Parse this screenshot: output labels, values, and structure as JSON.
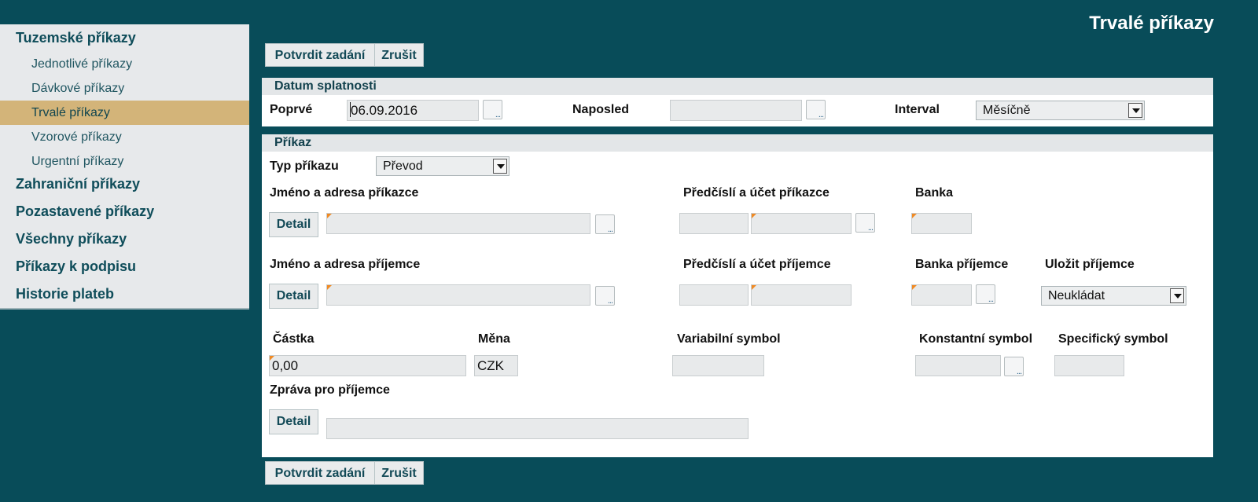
{
  "page_title": "Trvalé příkazy",
  "sidebar": {
    "tuzemske": {
      "title": "Tuzemské příkazy",
      "items": [
        "Jednotlivé příkazy",
        "Dávkové příkazy",
        "Trvalé příkazy",
        "Vzorové příkazy",
        "Urgentní příkazy"
      ],
      "active_item": "Trvalé příkazy"
    },
    "groups": [
      "Zahraniční příkazy",
      "Pozastavené příkazy",
      "Všechny příkazy",
      "Příkazy k podpisu",
      "Historie plateb"
    ]
  },
  "actions": {
    "confirm_label": "Potvrdit zadání",
    "cancel_label": "Zrušit"
  },
  "due": {
    "section_title": "Datum splatnosti",
    "first_label": "Poprvé",
    "first_value": "06.09.2016",
    "last_label": "Naposled",
    "last_value": "",
    "interval_label": "Interval",
    "interval_value": "Měsíčně"
  },
  "order": {
    "section_title": "Příkaz",
    "type_label": "Typ příkazu",
    "type_value": "Převod",
    "payer_name_label": "Jméno a adresa příkazce",
    "payer_account_label": "Předčíslí a účet příkazce",
    "payer_bank_label": "Banka",
    "payee_name_label": "Jméno a adresa příjemce",
    "payee_account_label": "Předčíslí a účet příjemce",
    "payee_bank_label": "Banka příjemce",
    "save_payee_label": "Uložit příjemce",
    "save_payee_value": "Neukládat",
    "detail_label": "Detail",
    "amount_label": "Částka",
    "amount_value": "0,00",
    "currency_label": "Měna",
    "currency_value": "CZK",
    "variable_symbol_label": "Variabilní symbol",
    "constant_symbol_label": "Konstantní symbol",
    "specific_symbol_label": "Specifický symbol",
    "message_label": "Zpráva pro příjemce"
  },
  "colors": {
    "background": "#084c59",
    "active_item": "#d3b479",
    "required_marker": "#f08a24"
  }
}
